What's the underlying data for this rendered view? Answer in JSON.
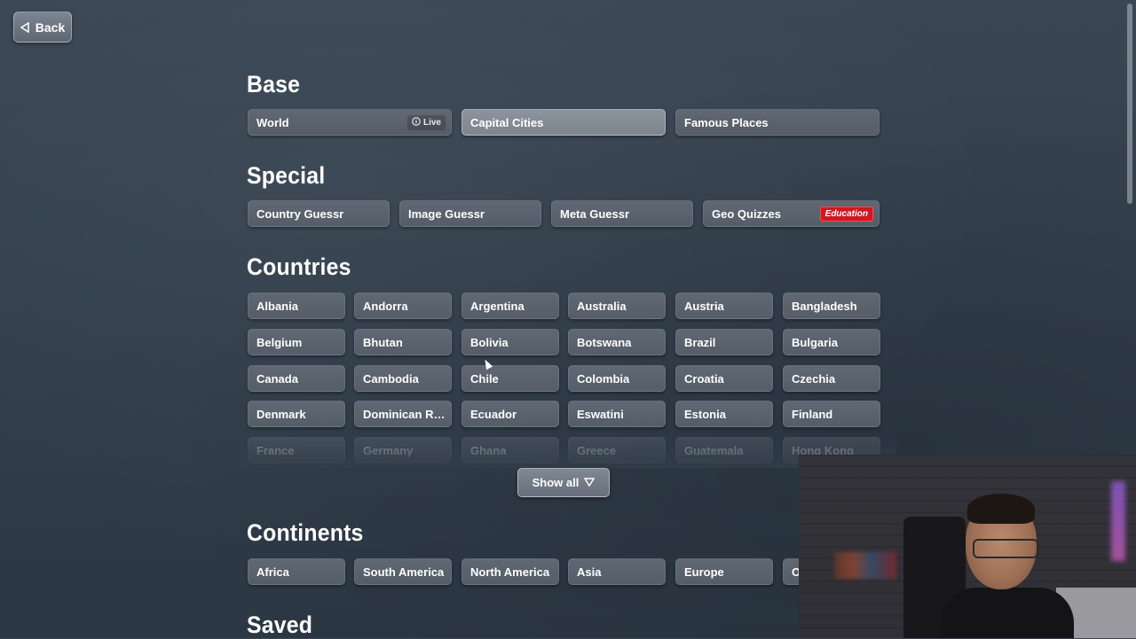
{
  "back_button": {
    "label": "Back"
  },
  "sections": {
    "base": {
      "title": "Base",
      "items": [
        {
          "label": "World",
          "badge": "Live"
        },
        {
          "label": "Capital Cities"
        },
        {
          "label": "Famous Places"
        }
      ]
    },
    "special": {
      "title": "Special",
      "items": [
        {
          "label": "Country Guessr"
        },
        {
          "label": "Image Guessr"
        },
        {
          "label": "Meta Guessr"
        },
        {
          "label": "Geo Quizzes",
          "badge": "Education"
        }
      ]
    },
    "countries": {
      "title": "Countries",
      "items": [
        "Albania",
        "Andorra",
        "Argentina",
        "Australia",
        "Austria",
        "Bangladesh",
        "Belgium",
        "Bhutan",
        "Bolivia",
        "Botswana",
        "Brazil",
        "Bulgaria",
        "Canada",
        "Cambodia",
        "Chile",
        "Colombia",
        "Croatia",
        "Czechia",
        "Denmark",
        "Dominican Repu...",
        "Ecuador",
        "Eswatini",
        "Estonia",
        "Finland",
        "France",
        "Germany",
        "Ghana",
        "Greece",
        "Guatemala",
        "Hong Kong"
      ],
      "show_all_label": "Show all"
    },
    "continents": {
      "title": "Continents",
      "items": [
        "Africa",
        "South America",
        "North America",
        "Asia",
        "Europe",
        "Oc"
      ]
    },
    "saved": {
      "title": "Saved"
    }
  },
  "colors": {
    "background": "#36424f",
    "tile": "#5a636e",
    "tile_selected": "#858d97",
    "education_badge": "#d01722"
  },
  "icons": {
    "back": "triangle-left-icon",
    "live": "info-circle-icon",
    "show_all": "triangle-down-icon"
  }
}
